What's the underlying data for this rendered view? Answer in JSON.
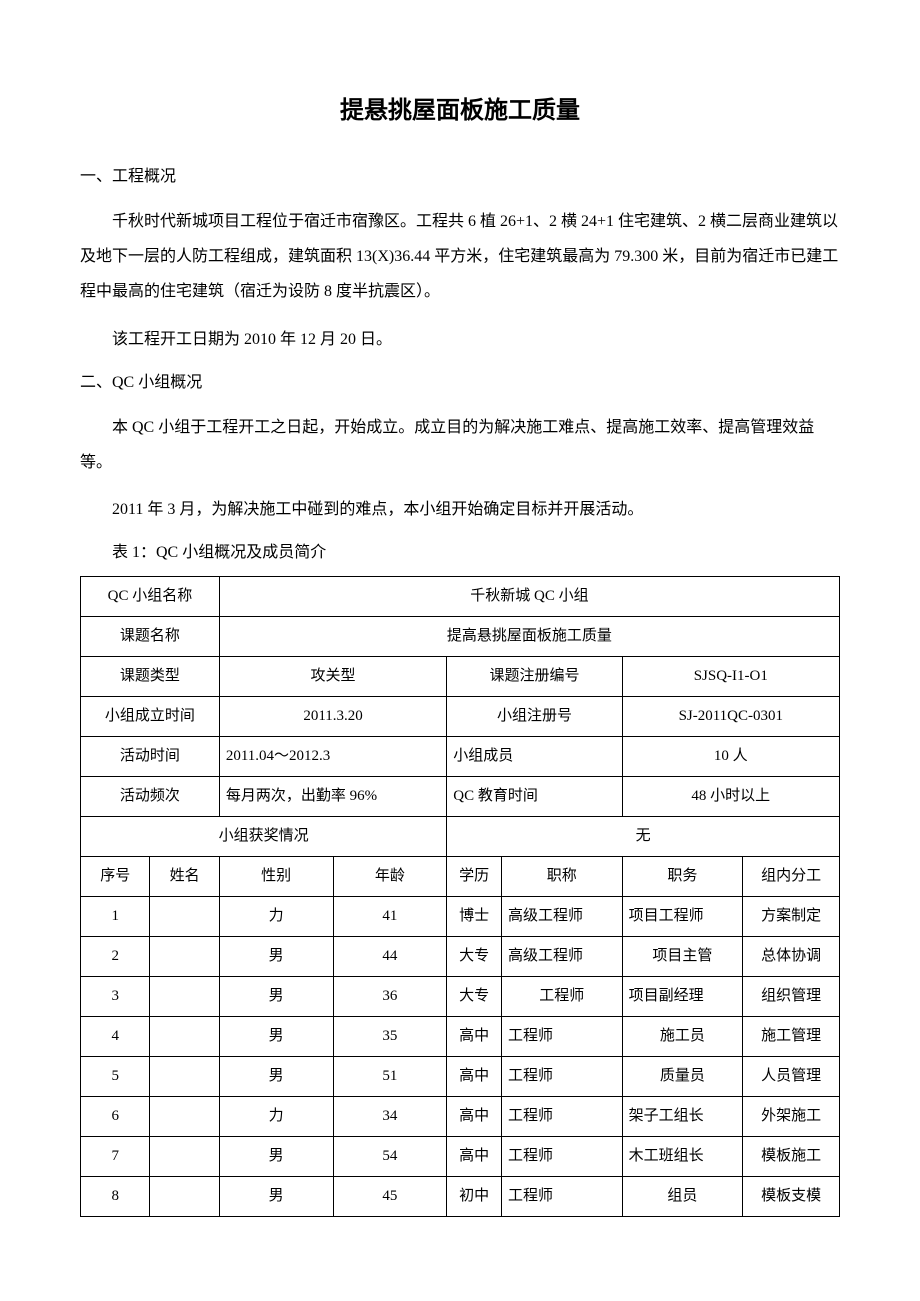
{
  "title": "提悬挑屋面板施工质量",
  "section1_heading": "一、工程概况",
  "para1": "千秋时代新城项目工程位于宿迁市宿豫区。工程共 6 植 26+1、2 横 24+1 住宅建筑、2 横二层商业建筑以及地下一层的人防工程组成，建筑面积 13(X)36.44 平方米，住宅建筑最高为 79.300 米，目前为宿迁市已建工程中最高的住宅建筑（宿迁为设防 8 度半抗震区）。",
  "para2": "该工程开工日期为 2010 年 12 月 20 日。",
  "section2_heading": "二、QC 小组概况",
  "para3": "本 QC 小组于工程开工之日起，开始成立。成立目的为解决施工难点、提高施工效率、提高管理效益等。",
  "para4": "2011 年 3 月，为解决施工中碰到的难点，本小组开始确定目标并开展活动。",
  "table_caption": "表 1：QC 小组概况及成员简介",
  "info": {
    "group_name_label": "QC 小组名称",
    "group_name_value": "千秋新城 QC 小组",
    "topic_name_label": "课题名称",
    "topic_name_value": "提高悬挑屋面板施工质量",
    "topic_type_label": "课题类型",
    "topic_type_value": "攻关型",
    "topic_reg_no_label": "课题注册编号",
    "topic_reg_no_value": "SJSQ-I1-O1",
    "establish_time_label": "小组成立时间",
    "establish_time_value": "2011.3.20",
    "group_reg_no_label": "小组注册号",
    "group_reg_no_value": "SJ-2011QC-0301",
    "activity_time_label": "活动时间",
    "activity_time_value": "2011.04～2012.3",
    "group_members_label": "小组成员",
    "group_members_value": "10 人",
    "activity_freq_label": "活动频次",
    "activity_freq_value": "每月两次，出勤率 96%",
    "qc_edu_time_label": "QC 教育时间",
    "qc_edu_time_value": "48 小时以上",
    "award_label": "小组获奖情况",
    "award_value": "无"
  },
  "headers": {
    "seq": "序号",
    "name": "姓名",
    "gender": "性别",
    "age": "年龄",
    "edu": "学历",
    "title": "职称",
    "role": "职务",
    "duty": "组内分工"
  },
  "members": [
    {
      "seq": "1",
      "name": "",
      "gender": "力",
      "age": "41",
      "edu": "博士",
      "title": "高级工程师",
      "role": "项目工程师",
      "duty": "方案制定"
    },
    {
      "seq": "2",
      "name": "",
      "gender": "男",
      "age": "44",
      "edu": "大专",
      "title": "高级工程师",
      "role": "项目主管",
      "duty": "总体协调"
    },
    {
      "seq": "3",
      "name": "",
      "gender": "男",
      "age": "36",
      "edu": "大专",
      "title": "工程师",
      "role": "项目副经理",
      "duty": "组织管理"
    },
    {
      "seq": "4",
      "name": "",
      "gender": "男",
      "age": "35",
      "edu": "高中",
      "title": "工程师",
      "role": "施工员",
      "duty": "施工管理"
    },
    {
      "seq": "5",
      "name": "",
      "gender": "男",
      "age": "51",
      "edu": "高中",
      "title": "工程师",
      "role": "质量员",
      "duty": "人员管理"
    },
    {
      "seq": "6",
      "name": "",
      "gender": "力",
      "age": "34",
      "edu": "高中",
      "title": "工程师",
      "role": "架子工组长",
      "duty": "外架施工"
    },
    {
      "seq": "7",
      "name": "",
      "gender": "男",
      "age": "54",
      "edu": "高中",
      "title": "工程师",
      "role": "木工班组长",
      "duty": "模板施工"
    },
    {
      "seq": "8",
      "name": "",
      "gender": "男",
      "age": "45",
      "edu": "初中",
      "title": "工程师",
      "role": "组员",
      "duty": "模板支模"
    }
  ]
}
